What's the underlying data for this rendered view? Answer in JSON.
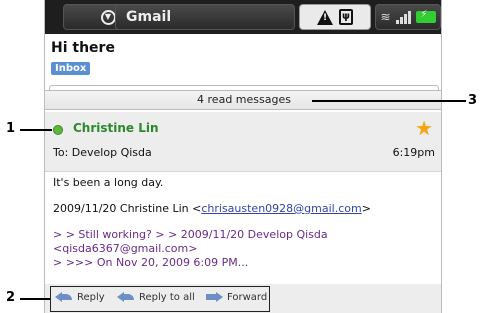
{
  "statusbar": {
    "app_title": "Gmail",
    "dropdown_icon": "circle-chevron-down-icon",
    "notification_icons": [
      "warning-icon",
      "usb-icon"
    ],
    "right_icons": [
      "wifi-icon",
      "signal-icon",
      "battery-charging-icon"
    ]
  },
  "conversation": {
    "subject": "Hi there",
    "label": "Inbox",
    "read_messages_banner": "4 read messages"
  },
  "message": {
    "sender": "Christine Lin",
    "to": "To: Develop Qisda",
    "time": "6:19pm",
    "starred": true,
    "body_line1": "It's been a long day.",
    "quote_intro": "2009/11/20 Christine Lin <",
    "quote_email": "chrisausten0928@gmail.com",
    "quote_intro_end": ">",
    "quoted_line1": "> > Still working? > > 2009/11/20 Develop Qisda <qisda6367@gmail.com>",
    "quoted_line2": "> >>> On Nov 20, 2009 6:09 PM..."
  },
  "actions": {
    "reply": "Reply",
    "reply_all": "Reply to all",
    "forward": "Forward"
  },
  "callouts": {
    "one": "1",
    "two": "2",
    "three": "3"
  },
  "colors": {
    "sender_green": "#2b8a2b",
    "star_gold": "#f2a60f",
    "label_blue": "#5a8fd0",
    "quoted_purple": "#6a2a88"
  }
}
